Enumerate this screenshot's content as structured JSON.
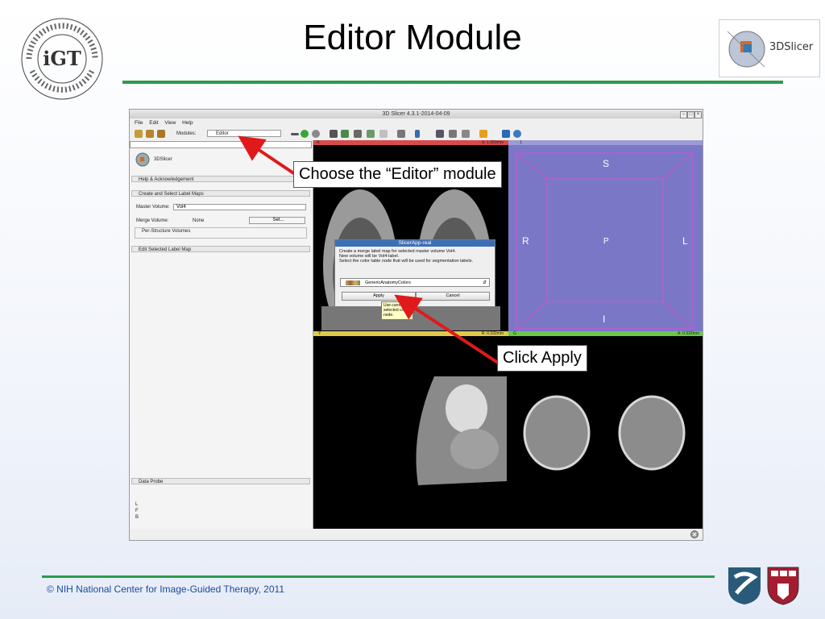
{
  "slide": {
    "title": "Editor Module",
    "footer": "© NIH National Center for Image-Guided Therapy, 2011",
    "slicer_logo_text": "3DSlicer",
    "igt_logo_arc_text": "NATIONAL CENTER FOR IMAGE-GUIDED THERAPY",
    "igt_logo_letters": "iGT"
  },
  "app": {
    "window_title": "3D Slicer 4.3.1-2014-04-09",
    "menu": [
      "File",
      "Edit",
      "View",
      "Help"
    ],
    "modules_label": "Modules:",
    "module_selected": "Editor",
    "left_panel": {
      "logo_text": "3DSlicer",
      "sections": {
        "help": "Help & Acknowledgement",
        "create": "Create and Select Label Maps",
        "per_structure": "Per-Structure Volumes",
        "edit": "Edit Selected Label Map",
        "data_probe": "Data Probe"
      },
      "master_volume_label": "Master Volume:",
      "master_volume_value": "Vol4",
      "merge_volume_label": "Merge Volume:",
      "merge_volume_value": "None",
      "set_button": "Set...",
      "probe_letters": [
        "L",
        "F",
        "B"
      ]
    },
    "views": {
      "red_slice": "S: 1.050mm",
      "yellow_slice": "R: 0.332mm",
      "green_slice": "A: 0.332mm",
      "red_letter": "R",
      "yellow_letter": "Y",
      "green_letter": "G",
      "view3d_number": "1",
      "axis_S": "S",
      "axis_R": "R",
      "axis_P": "P",
      "axis_L": "L",
      "axis_I": "I"
    },
    "dialog": {
      "title": "SlicerApp-real",
      "line1": "Create a merge label map for selected master volume Vol4.",
      "line2": "New volume will be Vol4-label.",
      "line3": "Select the color table node that will be used for segmentation labels.",
      "color_table": "GenericAnatomyColors",
      "apply": "Apply",
      "cancel": "Cancel",
      "tooltip": "Use current selected color node."
    }
  },
  "callouts": {
    "choose_editor": "Choose the “Editor” module",
    "click_apply": "Click Apply"
  },
  "colors": {
    "accent_green": "#2e9a4f",
    "arrow_red": "#e01a1a",
    "view3d_bg": "#7b77c7",
    "dialog_title": "#3b6fb8"
  }
}
